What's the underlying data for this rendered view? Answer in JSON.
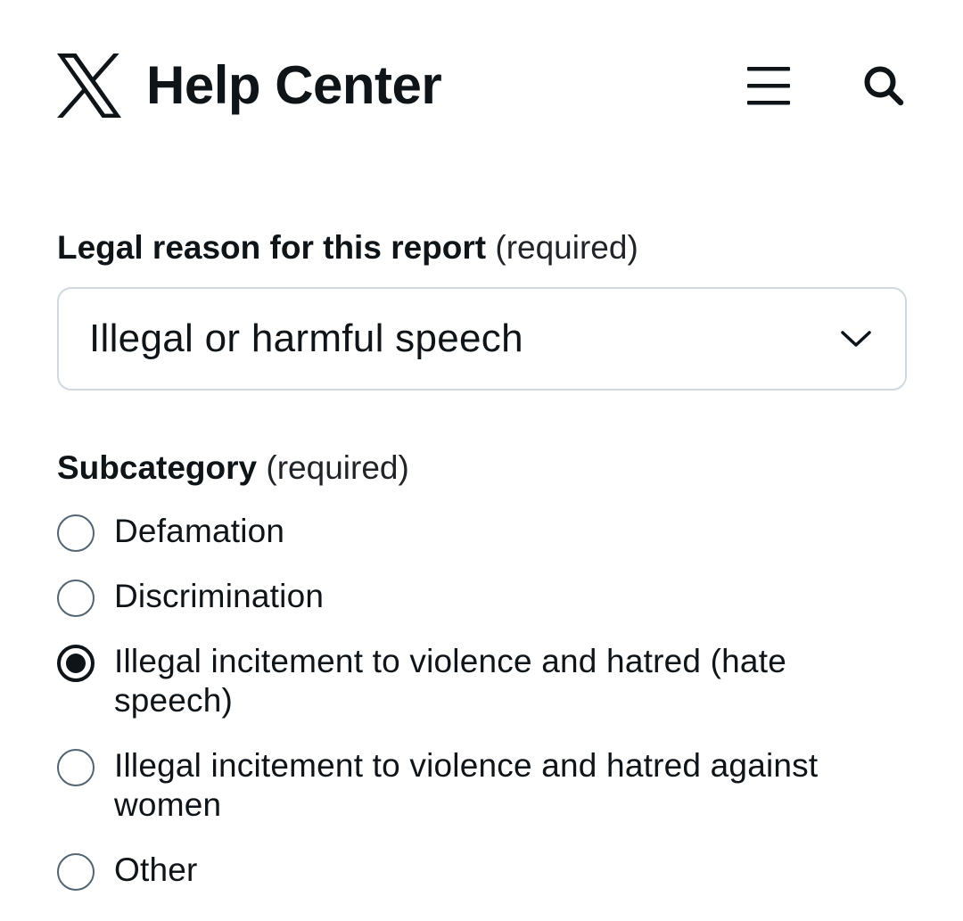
{
  "header": {
    "title": "Help Center",
    "logo_icon": "x-logo-icon",
    "menu_icon": "hamburger-menu-icon",
    "search_icon": "search-icon"
  },
  "form": {
    "legal_reason": {
      "label": "Legal reason for this report",
      "required_text": "(required)",
      "selected_value": "Illegal or harmful speech"
    },
    "subcategory": {
      "label": "Subcategory",
      "required_text": "(required)",
      "options": [
        {
          "label": "Defamation",
          "checked": false
        },
        {
          "label": "Discrimination",
          "checked": false
        },
        {
          "label": "Illegal incitement to violence and hatred (hate speech)",
          "checked": true
        },
        {
          "label": "Illegal incitement to violence and hatred against women",
          "checked": false
        },
        {
          "label": "Other",
          "checked": false
        }
      ]
    }
  },
  "colors": {
    "text": "#0f1419",
    "border": "#cfd9de",
    "radio_border": "#536471"
  }
}
